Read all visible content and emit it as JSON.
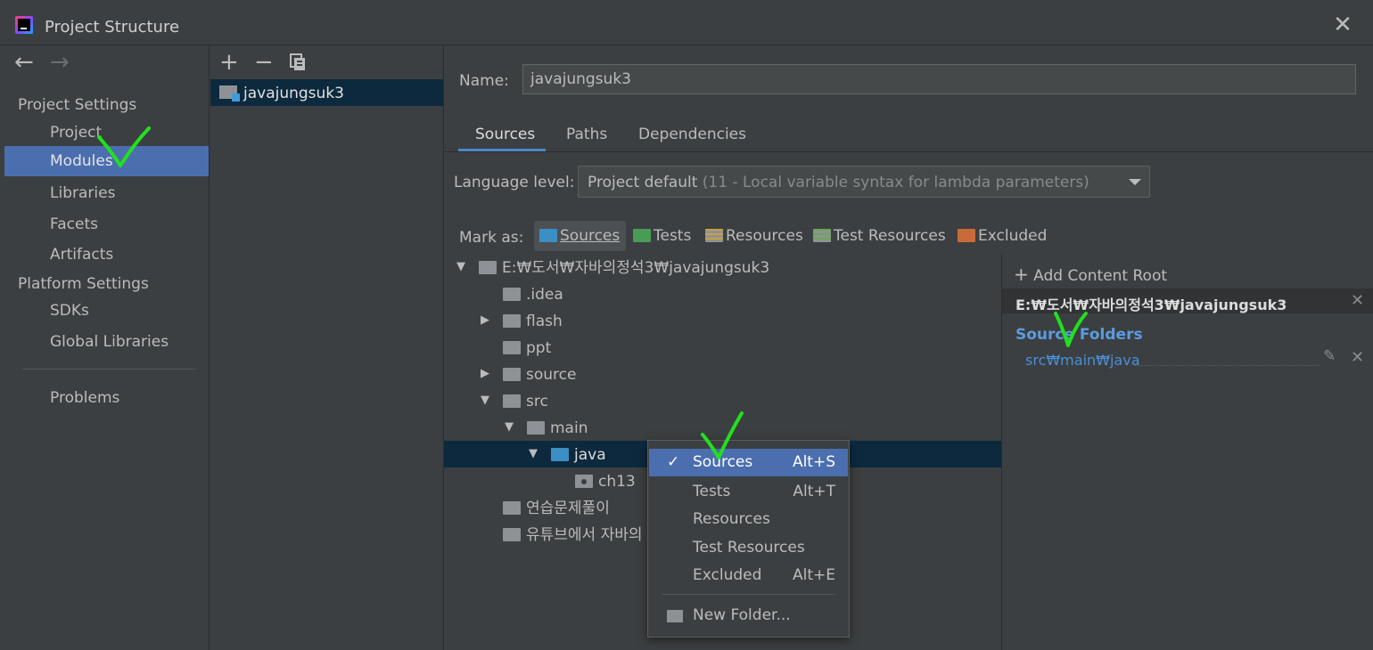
{
  "window": {
    "title": "Project Structure"
  },
  "sidebar": {
    "nav_back": "←",
    "nav_forward": "→",
    "project_settings_heading": "Project Settings",
    "project_settings_items": [
      "Project",
      "Modules",
      "Libraries",
      "Facets",
      "Artifacts"
    ],
    "platform_settings_heading": "Platform Settings",
    "platform_settings_items": [
      "SDKs",
      "Global Libraries"
    ],
    "problems": "Problems",
    "selected": "Modules"
  },
  "modules_list": {
    "toolbar": {
      "add": "+",
      "remove": "−"
    },
    "items": [
      "javajungsuk3"
    ]
  },
  "module": {
    "name_label": "Name:",
    "name_value": "javajungsuk3",
    "tabs": [
      "Sources",
      "Paths",
      "Dependencies"
    ],
    "active_tab": "Sources",
    "language_level_label": "Language level:",
    "language_level_value": "Project default",
    "language_level_hint": "(11 - Local variable syntax for lambda parameters)",
    "mark_as_label": "Mark as:",
    "mark_as_buttons": [
      "Sources",
      "Tests",
      "Resources",
      "Test Resources",
      "Excluded"
    ],
    "mark_as_selected": "Sources"
  },
  "tree": [
    {
      "label": "E:₩도서₩자바의정석3₩javajungsuk3",
      "expanded": true
    },
    {
      "label": ".idea"
    },
    {
      "label": "flash",
      "collapsed": true
    },
    {
      "label": "ppt"
    },
    {
      "label": "source",
      "collapsed": true
    },
    {
      "label": "src",
      "expanded": true
    },
    {
      "label": "main",
      "expanded": true
    },
    {
      "label": "java",
      "expanded": true,
      "selected": true,
      "type": "sources"
    },
    {
      "label": "ch13",
      "type": "package"
    },
    {
      "label": "연습문제풀이"
    },
    {
      "label": "유튜브에서 자바의"
    }
  ],
  "content_root": {
    "add_label": "Add Content Root",
    "root_path": "E:₩도서₩자바의정석3₩javajungsuk3",
    "source_folders_heading": "Source Folders",
    "source_folders": [
      "src₩main₩java"
    ]
  },
  "context_menu": {
    "items": [
      {
        "label": "Sources",
        "shortcut": "Alt+S",
        "checked": true
      },
      {
        "label": "Tests",
        "shortcut": "Alt+T"
      },
      {
        "label": "Resources",
        "shortcut": ""
      },
      {
        "label": "Test Resources",
        "shortcut": ""
      },
      {
        "label": "Excluded",
        "shortcut": "Alt+E"
      },
      {
        "label": "New Folder...",
        "shortcut": ""
      }
    ]
  },
  "colors": {
    "background": "#3c3f41",
    "selection": "#4b6eaf",
    "tree_selection": "#0d293e",
    "sources_folder": "#3b8fc4",
    "tests_folder": "#499c54",
    "excluded_folder": "#c96a3a",
    "annotation_check": "#22e01e"
  }
}
